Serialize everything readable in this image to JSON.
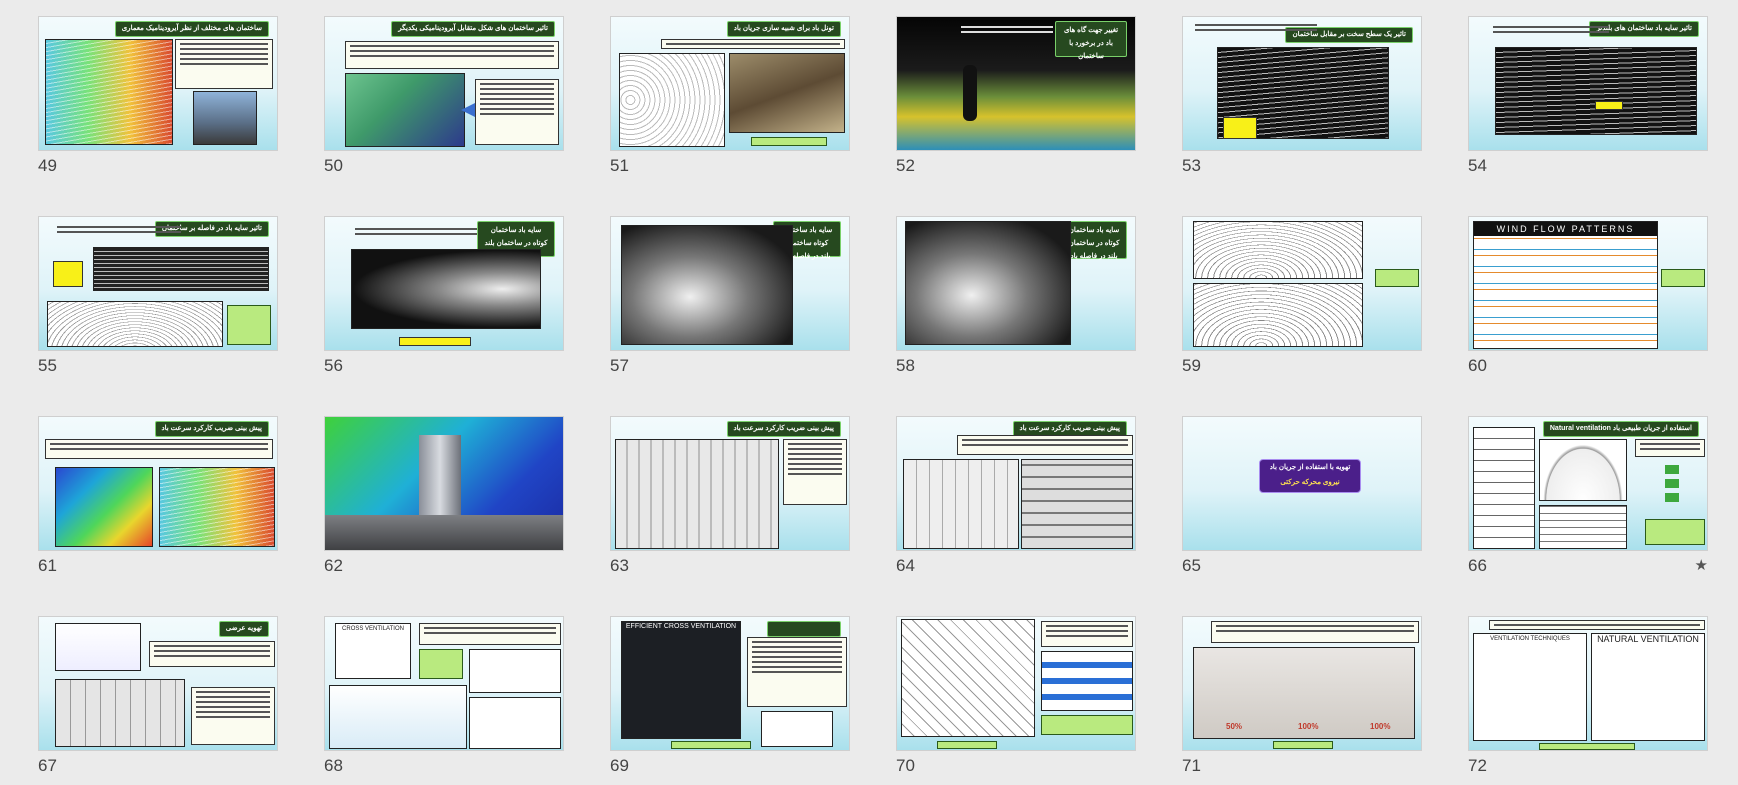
{
  "view": "slide-sorter",
  "slides": [
    {
      "number": "49",
      "title": "ساختمان های مختلف از نظر آیرودینامیک معماری"
    },
    {
      "number": "50",
      "title": "تاثیر ساختمان های شکل متقابل آیرودینامیکی یکدیگر"
    },
    {
      "number": "51",
      "title": "تونل باد برای شبیه سازی جریان باد"
    },
    {
      "number": "52",
      "title": "تغییر جهت گاه های باد در برخورد با ساختمان"
    },
    {
      "number": "53",
      "title": "تاثیر یک سطح سخت بر مقابل ساختمان"
    },
    {
      "number": "54",
      "title": "تاثیر سایه باد ساختمان های بلندتر"
    },
    {
      "number": "55",
      "title": "تاثیر سایه باد در فاصله بر ساختمان"
    },
    {
      "number": "56",
      "title": "سایه باد ساختمان کوتاه در ساختمان بلند"
    },
    {
      "number": "57",
      "title": "سایه باد ساختمان کوتاه ساختمان بلند در فاصله آن"
    },
    {
      "number": "58",
      "title": "سایه باد ساختمان کوتاه در ساختمان بلند در فاصله باد"
    },
    {
      "number": "59",
      "title": ""
    },
    {
      "number": "60",
      "title": "WIND FLOW PATTERNS"
    },
    {
      "number": "61",
      "title": "پیش بینی ضریب کارکرد سرعت باد"
    },
    {
      "number": "62",
      "title": ""
    },
    {
      "number": "63",
      "title": "پیش بینی ضریب کارکرد سرعت باد"
    },
    {
      "number": "64",
      "title": "پیش بینی ضریب کارکرد سرعت باد"
    },
    {
      "number": "65",
      "title": "تهویه با استفاده از جریان باد",
      "subtitle": "نیروی محرکه حرکتی"
    },
    {
      "number": "66",
      "title": "Natural ventilation استفاده از جریان طبیعی باد",
      "starred": true
    },
    {
      "number": "67",
      "title": "تهویه عرضی"
    },
    {
      "number": "68",
      "title": "CROSS VENTILATION"
    },
    {
      "number": "69",
      "title": "EFFICIENT CROSS VENTILATION"
    },
    {
      "number": "70",
      "title": ""
    },
    {
      "number": "71",
      "title": "",
      "labels": [
        "50%",
        "100%",
        "100%"
      ]
    },
    {
      "number": "72",
      "title": "NATURAL VENTILATION",
      "subtitle": "VENTILATION TECHNIQUES"
    }
  ],
  "icons": {
    "star": "★"
  }
}
